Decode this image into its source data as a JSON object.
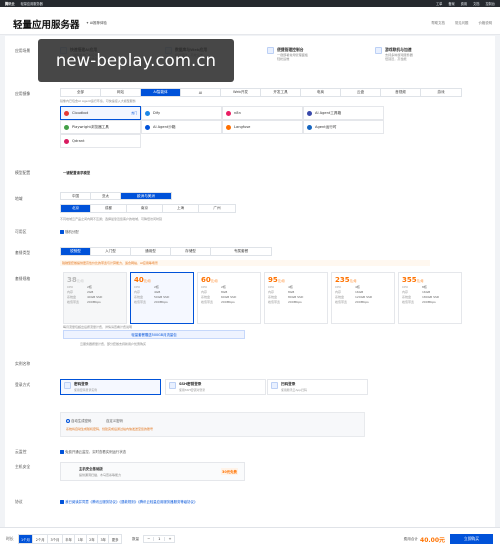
{
  "topnav": {
    "brand": "腾讯云",
    "product": "轻量应用服务器",
    "items": [
      "工单",
      "备案",
      "费用",
      "文档",
      "控制台"
    ]
  },
  "header": {
    "title": "轻量应用服务器",
    "badge": "AI推荐体验",
    "links": [
      "帮助文档",
      "常见问题",
      "价格说明"
    ]
  },
  "labels": {
    "scenario": "应用场景",
    "image_type": "应用镜像",
    "region": "地域",
    "zone": "可用区",
    "package_type": "套餐类型",
    "package": "套餐规格",
    "login": "登录方式",
    "instance": "实例名称",
    "monitor": "云监控",
    "extras": "主机安全",
    "agree": "协议"
  },
  "scenarios": [
    {
      "title": "快速搭建AI应用",
      "desc": "一键部署热门AI应用\n开箱即用，快速体验"
    },
    {
      "title": "数据库与Web应用",
      "desc": "极简搭建，高效运维\n稳定可靠"
    },
    {
      "title": "便捷管理控制台",
      "desc": "一键部署常用管理面板\n轻松运维"
    },
    {
      "title": "游戏联机与加速",
      "desc": "支持多种游戏服务器\n低延迟，高性能"
    }
  ],
  "image_tabs": [
    "全部",
    "网站",
    "AI智能体",
    "AI",
    "Web开发",
    "开发工具",
    "电商",
    "云盘",
    "音视频",
    "游戏"
  ],
  "images": [
    {
      "name": "Cloudbot",
      "color": "#e53935",
      "tag": "热门"
    },
    {
      "name": "Dify",
      "color": "#1e88e5"
    },
    {
      "name": "n8n",
      "color": "#e91e63"
    },
    {
      "name": "AI Agent工具箱",
      "color": "#3949ab"
    },
    {
      "name": "Playwright浏览器工具",
      "color": "#43a047"
    },
    {
      "name": "AI Agent沙箱",
      "color": "#0052d9"
    },
    {
      "name": "Langfuse",
      "color": "#ff6f00"
    },
    {
      "name": "Agent运行时",
      "color": "#1565c0"
    },
    {
      "name": "Qdrant",
      "color": "#d81b60"
    }
  ],
  "image_note": "一键配置请求模型",
  "image_hint": "镜像内已包含AI Agent运行环境，可快速接入大模型服务",
  "region_tabs": [
    "中国",
    "亚太",
    "欧洲与美洲"
  ],
  "region_cities": [
    "北京",
    "成都",
    "南京",
    "上海",
    "广州"
  ],
  "region_hint": "不同地域云产品之间内网不互通；选择最靠近您客户的地域，可降低访问时延",
  "zone": "随机分配",
  "pkg_type_tabs": [
    "锐驰型",
    "入门型",
    "通用型",
    "存储型",
    "专属套餐"
  ],
  "pkg_type_hint": "锐驰型套餐提供更高性价比的带宽与计算能力，适合网站、AI应用等场景",
  "packages": [
    {
      "price": "38",
      "unit": "元/月",
      "cpu": "2核",
      "mem": "2GB",
      "disk": "40GB SSD",
      "bw": "200Mbps",
      "off": true
    },
    {
      "price": "40",
      "unit": "元/月",
      "cpu": "2核",
      "mem": "4GB",
      "disk": "50GB SSD",
      "bw": "200Mbps"
    },
    {
      "price": "60",
      "unit": "元/月",
      "cpu": "2核",
      "mem": "8GB",
      "disk": "60GB SSD",
      "bw": "200Mbps"
    },
    {
      "price": "95",
      "unit": "元/月",
      "cpu": "4核",
      "mem": "8GB",
      "disk": "80GB SSD",
      "bw": "200Mbps"
    },
    {
      "price": "235",
      "unit": "元/月",
      "cpu": "4核",
      "mem": "16GB",
      "disk": "120GB SSD",
      "bw": "200Mbps"
    },
    {
      "price": "355",
      "unit": "元/月",
      "cpu": "8核",
      "mem": "16GB",
      "disk": "180GB SSD",
      "bw": "200Mbps"
    }
  ],
  "spec_keys": {
    "cpu": "CPU",
    "mem": "内存",
    "disk": "系统盘",
    "bw": "峰值带宽"
  },
  "pkg_hint": "每月流量包超出后按流量计费，详情请查看计费说明",
  "pkg_banner": "轻量套餐赠送500GB月流量包",
  "pkg_banner_sub": "云服务器按量计费，部分套餐支持新用户优惠购买",
  "logins": [
    {
      "title": "密码登录",
      "desc": "使用密码登录实例"
    },
    {
      "title": "SSH密钥登录",
      "desc": "使用SSH密钥对登录"
    },
    {
      "title": "扫码登录",
      "desc": "使用腾讯云App扫码"
    }
  ],
  "pwd_opts": [
    "自动生成密码",
    "自定义密码"
  ],
  "pwd_hint": "系统将自动生成随机密码，创建完成后通过站内信发送至您的账号",
  "monitor_opt": "免费开通云监控，实时查看实例运行状态",
  "security_title": "主机安全基础版",
  "security_desc": "提供漏洞扫描、木马查杀等能力",
  "security_price": "30元免费",
  "agree": "我已阅读并同意《腾讯云服务协议》《退款规则》《腾讯云轻量应用服务器服务等级协议》",
  "footer": {
    "label": "时长",
    "durations": [
      "1个月",
      "2个月",
      "3个月",
      "半年",
      "1年",
      "2年",
      "3年",
      "更多"
    ],
    "qty_label": "数量",
    "qty": "1",
    "total_label": "费用合计",
    "total": "40.00元",
    "buy": "立即购买"
  },
  "watermark": "new-beplay.com.cn",
  "colors": {
    "accent": "#0052d9",
    "price": "#ff7200"
  }
}
